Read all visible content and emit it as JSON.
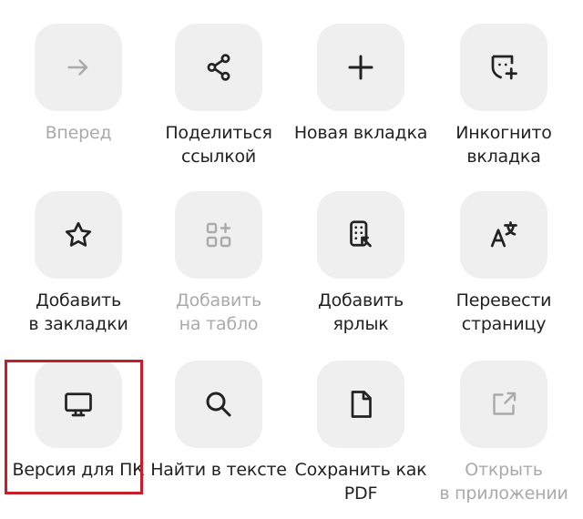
{
  "menu": {
    "tiles": [
      {
        "icon": "arrow-right-icon",
        "lines": [
          "Вперед"
        ],
        "enabled": false
      },
      {
        "icon": "share-icon",
        "lines": [
          "Поделиться",
          "ссылкой"
        ],
        "enabled": true
      },
      {
        "icon": "plus-icon",
        "lines": [
          "Новая вкладка"
        ],
        "enabled": true
      },
      {
        "icon": "incognito-mask-icon",
        "lines": [
          "Инкогнито",
          "вкладка"
        ],
        "enabled": true
      },
      {
        "icon": "star-icon",
        "lines": [
          "Добавить",
          "в закладки"
        ],
        "enabled": true
      },
      {
        "icon": "grid-plus-icon",
        "lines": [
          "Добавить",
          "на табло"
        ],
        "enabled": false
      },
      {
        "icon": "shortcut-icon",
        "lines": [
          "Добавить",
          "ярлык"
        ],
        "enabled": true
      },
      {
        "icon": "translate-icon",
        "lines": [
          "Перевести",
          "страницу"
        ],
        "enabled": true
      },
      {
        "icon": "desktop-monitor-icon",
        "lines": [
          "Версия для ПК"
        ],
        "enabled": true
      },
      {
        "icon": "search-icon",
        "lines": [
          "Найти в тексте"
        ],
        "enabled": true
      },
      {
        "icon": "document-icon",
        "lines": [
          "Сохранить как",
          "PDF"
        ],
        "enabled": true
      },
      {
        "icon": "open-external-icon",
        "lines": [
          "Открыть",
          "в приложении"
        ],
        "enabled": false
      }
    ],
    "highlight_color": "#c81e2a",
    "tile_bg": "#efefef",
    "text_color": "#222222",
    "disabled_color": "#aaaaaa"
  }
}
